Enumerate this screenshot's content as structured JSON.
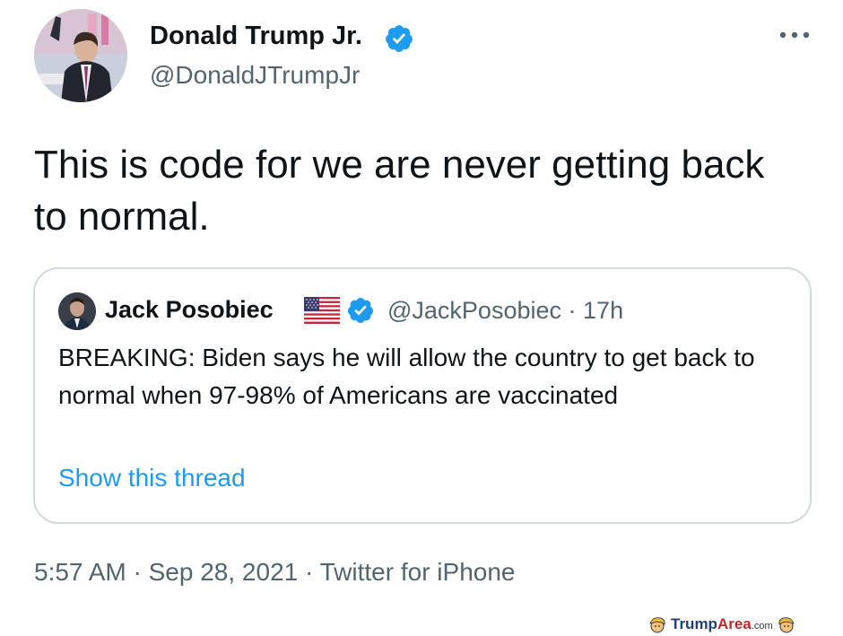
{
  "tweet": {
    "author": {
      "name": "Donald Trump Jr.",
      "handle": "@DonaldJTrumpJr",
      "verified": true
    },
    "text": "This is code for we are never getting back to normal.",
    "more_icon": "more-horizontal-icon",
    "timestamp": "5:57 AM",
    "date": "Sep 28, 2021",
    "source": "Twitter for iPhone",
    "separator": "·"
  },
  "quote": {
    "author": {
      "name": "Jack Posobiec",
      "flag": "us-flag-icon",
      "verified": true,
      "handle": "@JackPosobiec",
      "time": "17h"
    },
    "separator": "·",
    "text": "BREAKING: Biden says he will allow the country to get back to normal when 97-98% of Americans are vaccinated",
    "show_thread": "Show this thread"
  },
  "watermark": {
    "logo_text_1": "Trump",
    "logo_text_2": "Area",
    "logo_text_3": ".com"
  },
  "colors": {
    "verified_blue": "#1d9bf0",
    "secondary_text": "#536471",
    "border": "#cfd9de",
    "primary_text": "#0f1419"
  }
}
